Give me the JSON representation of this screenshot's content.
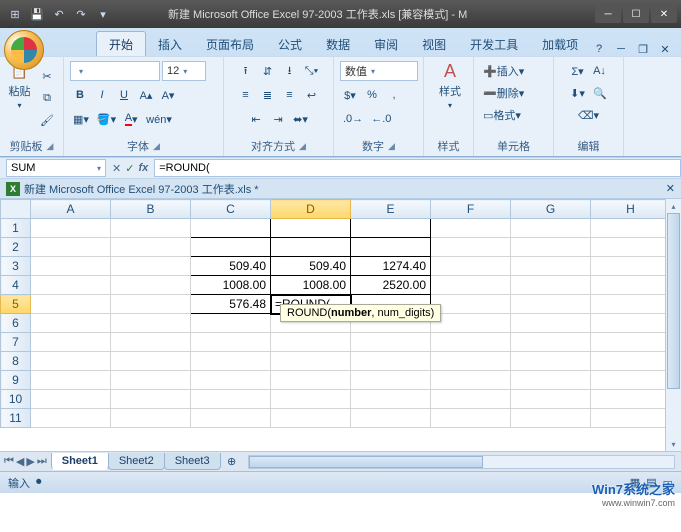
{
  "title": "新建 Microsoft Office Excel 97-2003 工作表.xls  [兼容模式] - M",
  "tabs": [
    "开始",
    "插入",
    "页面布局",
    "公式",
    "数据",
    "审阅",
    "视图",
    "开发工具",
    "加载项"
  ],
  "active_tab": 0,
  "ribbon": {
    "clipboard": {
      "label": "剪贴板",
      "paste": "粘贴"
    },
    "font": {
      "label": "字体",
      "name": "",
      "size": "12"
    },
    "alignment": {
      "label": "对齐方式"
    },
    "number": {
      "label": "数字",
      "format": "数值"
    },
    "styles": {
      "label": "样式",
      "btn": "样式"
    },
    "cells": {
      "label": "单元格",
      "insert": "插入",
      "delete": "删除",
      "format": "格式"
    },
    "editing": {
      "label": "编辑"
    }
  },
  "namebox": "SUM",
  "formula": "=ROUND(",
  "workbook_caption": "新建 Microsoft Office Excel 97-2003 工作表.xls *",
  "columns": [
    "A",
    "B",
    "C",
    "D",
    "E",
    "F",
    "G",
    "H"
  ],
  "rows": 11,
  "active": {
    "row": 5,
    "col": "D"
  },
  "cells": {
    "C3": "509.40",
    "D3": "509.40",
    "E3": "1274.40",
    "C4": "1008.00",
    "D4": "1008.00",
    "E4": "2520.00",
    "C5": "576.48",
    "D5": "=ROUND("
  },
  "boxed_range": {
    "r1": 1,
    "r2": 5,
    "cols": [
      "C",
      "D",
      "E"
    ]
  },
  "tooltip": {
    "fn": "ROUND",
    "args": "(number, num_digits)",
    "bold_arg": "number"
  },
  "sheets": [
    "Sheet1",
    "Sheet2",
    "Sheet3"
  ],
  "active_sheet": 0,
  "status": "输入",
  "watermark": {
    "main": "Win7系统之家",
    "sub": "www.winwin7.com"
  }
}
